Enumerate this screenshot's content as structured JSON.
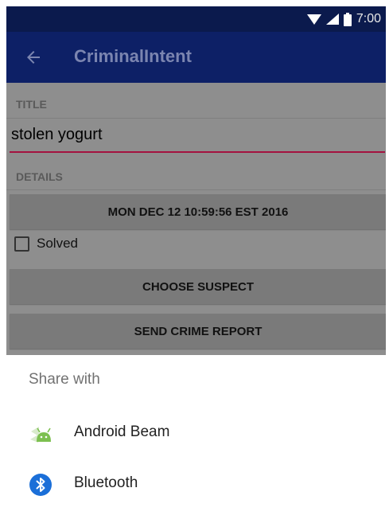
{
  "status_bar": {
    "time": "7:00",
    "icons": [
      "wifi-icon",
      "signal-icon",
      "battery-icon"
    ]
  },
  "app_bar": {
    "title": "CriminalIntent",
    "nav_icon": "back-arrow-icon"
  },
  "crime_form": {
    "title_section": "TITLE",
    "title_value": "stolen yogurt",
    "details_section": "DETAILS",
    "date_button": "MON DEC 12 10:59:56 EST 2016",
    "solved_label": "Solved",
    "solved_checked": false,
    "suspect_button": "CHOOSE SUSPECT",
    "report_button": "SEND CRIME REPORT"
  },
  "share_sheet": {
    "header": "Share with",
    "items": [
      {
        "label": "Android Beam",
        "icon": "android-beam-icon"
      },
      {
        "label": "Bluetooth",
        "icon": "bluetooth-icon"
      }
    ]
  },
  "colors": {
    "status_bar": "#0b1a4d",
    "app_bar": "#0d2066",
    "accent": "#a4123f",
    "scrim": "#8e8e8e",
    "bluetooth": "#1b6fd8",
    "android": "#7cc04f"
  }
}
